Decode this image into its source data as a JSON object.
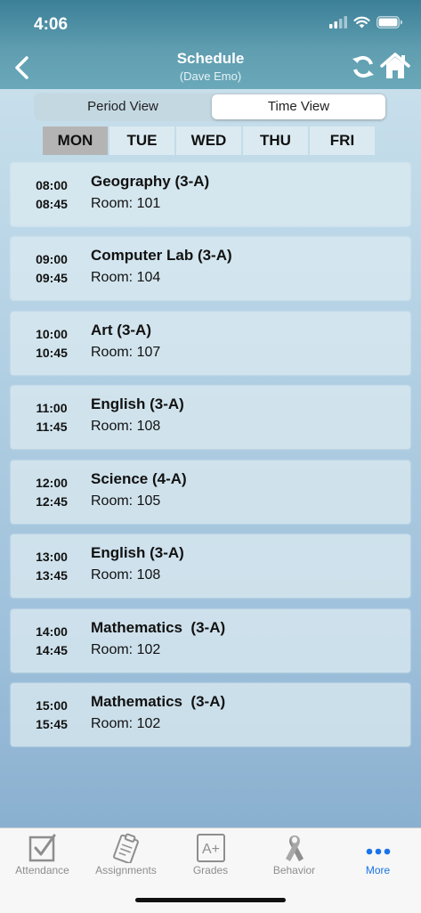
{
  "status": {
    "time": "4:06"
  },
  "nav": {
    "title": "Schedule",
    "subtitle": "(Dave Emo)"
  },
  "view_toggle": {
    "options": [
      "Period View",
      "Time View"
    ],
    "selected": "Time View"
  },
  "days": {
    "items": [
      "MON",
      "TUE",
      "WED",
      "THU",
      "FRI"
    ],
    "selected": "MON"
  },
  "schedule": [
    {
      "start": "08:00",
      "end": "08:45",
      "subject": "Geography (3-A)",
      "room": "Room: 101"
    },
    {
      "start": "09:00",
      "end": "09:45",
      "subject": "Computer Lab (3-A)",
      "room": "Room: 104"
    },
    {
      "start": "10:00",
      "end": "10:45",
      "subject": "Art (3-A)",
      "room": "Room: 107"
    },
    {
      "start": "11:00",
      "end": "11:45",
      "subject": "English (3-A)",
      "room": "Room: 108"
    },
    {
      "start": "12:00",
      "end": "12:45",
      "subject": "Science (4-A)",
      "room": "Room: 105"
    },
    {
      "start": "13:00",
      "end": "13:45",
      "subject": "English (3-A)",
      "room": "Room: 108"
    },
    {
      "start": "14:00",
      "end": "14:45",
      "subject": "Mathematics  (3-A)",
      "room": "Room: 102"
    },
    {
      "start": "15:00",
      "end": "15:45",
      "subject": "Mathematics  (3-A)",
      "room": "Room: 102"
    }
  ],
  "tabbar": {
    "items": [
      {
        "label": "Attendance",
        "icon": "checkbox-icon"
      },
      {
        "label": "Assignments",
        "icon": "clipboard-icon"
      },
      {
        "label": "Grades",
        "icon": "grade-a-plus-icon"
      },
      {
        "label": "Behavior",
        "icon": "ribbon-icon"
      },
      {
        "label": "More",
        "icon": "more-dots-icon"
      }
    ],
    "selected": "More"
  },
  "colors": {
    "accent": "#1a73e8",
    "header": "#4f91a8",
    "inactive_tab": "#8e8e8e"
  }
}
